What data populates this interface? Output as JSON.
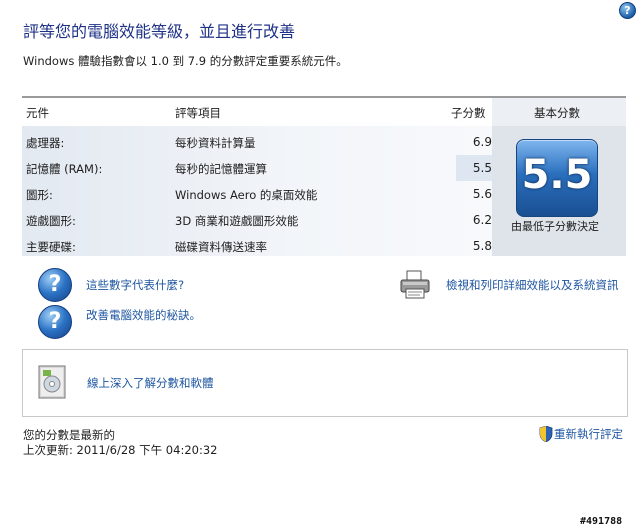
{
  "header": {
    "help_icon": "?",
    "title": "評等您的電腦效能等級，並且進行改善",
    "subtitle": "Windows 體驗指數會以 1.0 到 7.9 的分數評定重要系統元件。"
  },
  "table": {
    "columns": [
      "元件",
      "評等項目",
      "子分數",
      "基本分數"
    ],
    "rows": [
      {
        "component": "處理器:",
        "rating": "每秒資料計算量",
        "subscore": "6.9"
      },
      {
        "component": "記憶體 (RAM):",
        "rating": "每秒的記憶體運算",
        "subscore": "5.5"
      },
      {
        "component": "圖形:",
        "rating": "Windows Aero 的桌面效能",
        "subscore": "5.6"
      },
      {
        "component": "遊戲圖形:",
        "rating": "3D 商業和遊戲圖形效能",
        "subscore": "6.2"
      },
      {
        "component": "主要硬碟:",
        "rating": "磁碟資料傳送速率",
        "subscore": "5.8"
      }
    ],
    "base_score": "5.5",
    "base_score_caption": "由最低子分數決定"
  },
  "links": {
    "what_numbers_mean": "這些數字代表什麼?",
    "tips": "改善電腦效能的秘訣。",
    "print_details": "檢視和列印詳細效能以及系統資訊",
    "learn_online": "線上深入了解分數和軟體"
  },
  "status": {
    "current": "您的分數是最新的",
    "last_update": "上次更新: 2011/6/28 下午 04:20:32",
    "rerun": "重新執行評定"
  },
  "watermark": "#491788",
  "colors": {
    "title": "#1e3287",
    "link": "#1e56a0",
    "badge": "#2a6fbd"
  }
}
